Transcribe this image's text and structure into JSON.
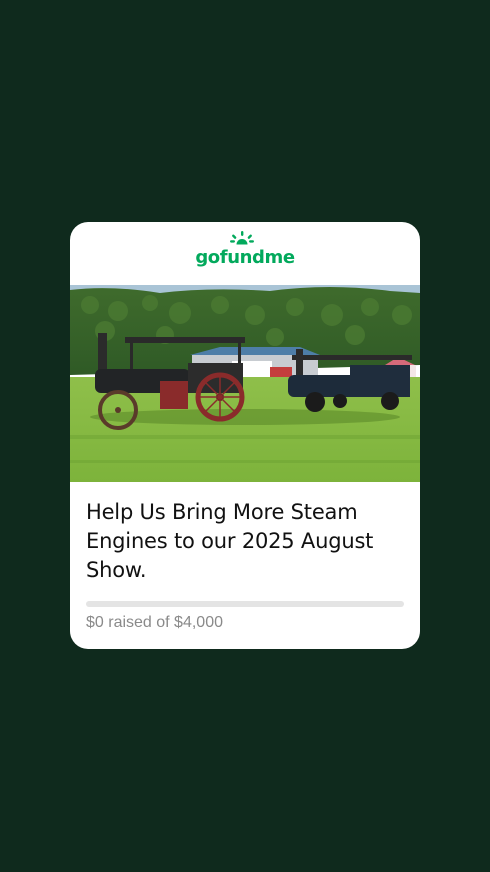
{
  "widget": {
    "brand": "gofundme",
    "title": "Help Us Bring More Steam Engines to our 2025 August Show.",
    "raised_text": "$0 raised of $4,000",
    "progress_fraction": 0,
    "colors": {
      "page_background": "#0f2a1d",
      "brand_green": "#02a95c",
      "card_background": "#ffffff",
      "progress_track": "#e4e4e4",
      "muted_text": "#8a8a8a"
    },
    "image": {
      "subject": "steam-traction-engines-on-field-photo"
    }
  }
}
